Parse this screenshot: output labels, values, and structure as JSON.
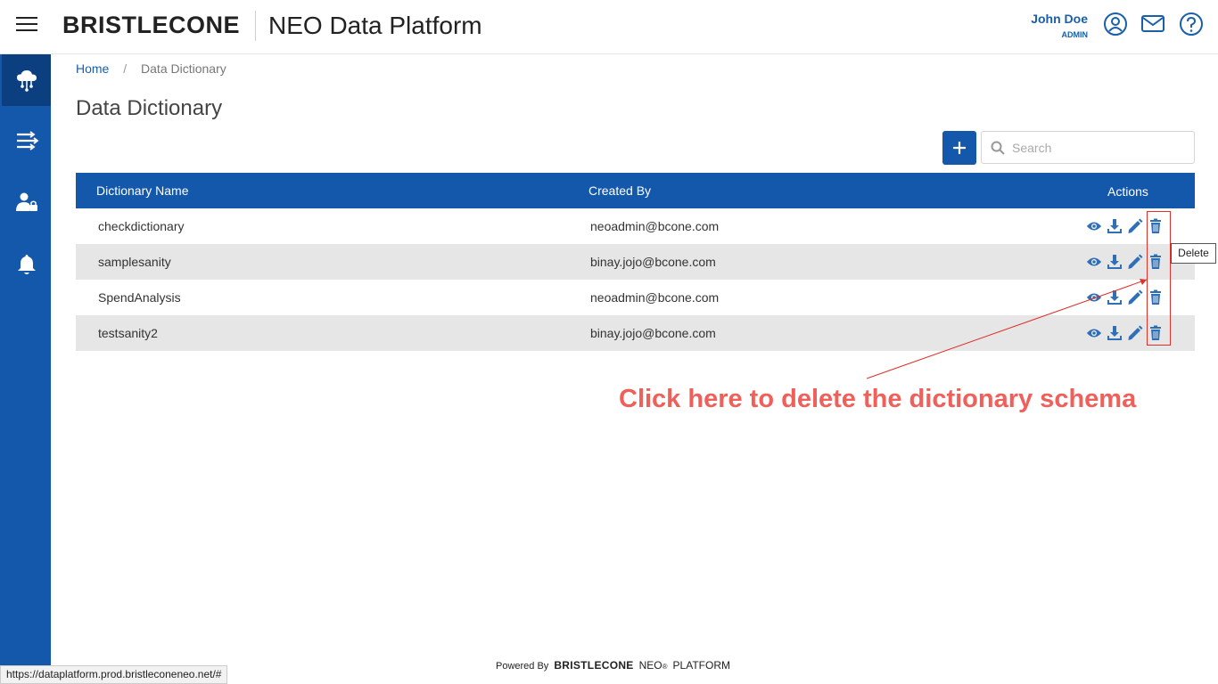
{
  "header": {
    "brand": "BRISTLECONE",
    "app_title": "NEO Data Platform",
    "user_name": "John Doe",
    "user_role": "ADMIN"
  },
  "breadcrumb": {
    "home": "Home",
    "separator": "/",
    "current": "Data Dictionary"
  },
  "page_title": "Data Dictionary",
  "search": {
    "placeholder": "Search",
    "value": ""
  },
  "table": {
    "headers": {
      "name": "Dictionary Name",
      "created_by": "Created By",
      "actions": "Actions"
    },
    "rows": [
      {
        "name": "checkdictionary",
        "created_by": "neoadmin@bcone.com"
      },
      {
        "name": "samplesanity",
        "created_by": "binay.jojo@bcone.com"
      },
      {
        "name": "SpendAnalysis",
        "created_by": "neoadmin@bcone.com"
      },
      {
        "name": "testsanity2",
        "created_by": "binay.jojo@bcone.com"
      }
    ]
  },
  "tooltip": "Delete",
  "annotation": "Click here to delete the dictionary schema",
  "footer": {
    "powered_by": "Powered By",
    "brand": "BRISTLECONE",
    "neo": "NEO",
    "reg": "®",
    "platform": "PLATFORM"
  },
  "status_url": "https://dataplatform.prod.bristleconeneo.net/#",
  "colors": {
    "primary": "#1458ab",
    "annotation": "#f0605a",
    "row_alt": "#e6e6e6"
  },
  "icons": {
    "sidebar": [
      "cloud-network-icon",
      "pipeline-icon",
      "user-lock-icon",
      "bell-icon"
    ],
    "row_actions": [
      "eye-icon",
      "download-icon",
      "pencil-icon",
      "trash-icon"
    ]
  }
}
